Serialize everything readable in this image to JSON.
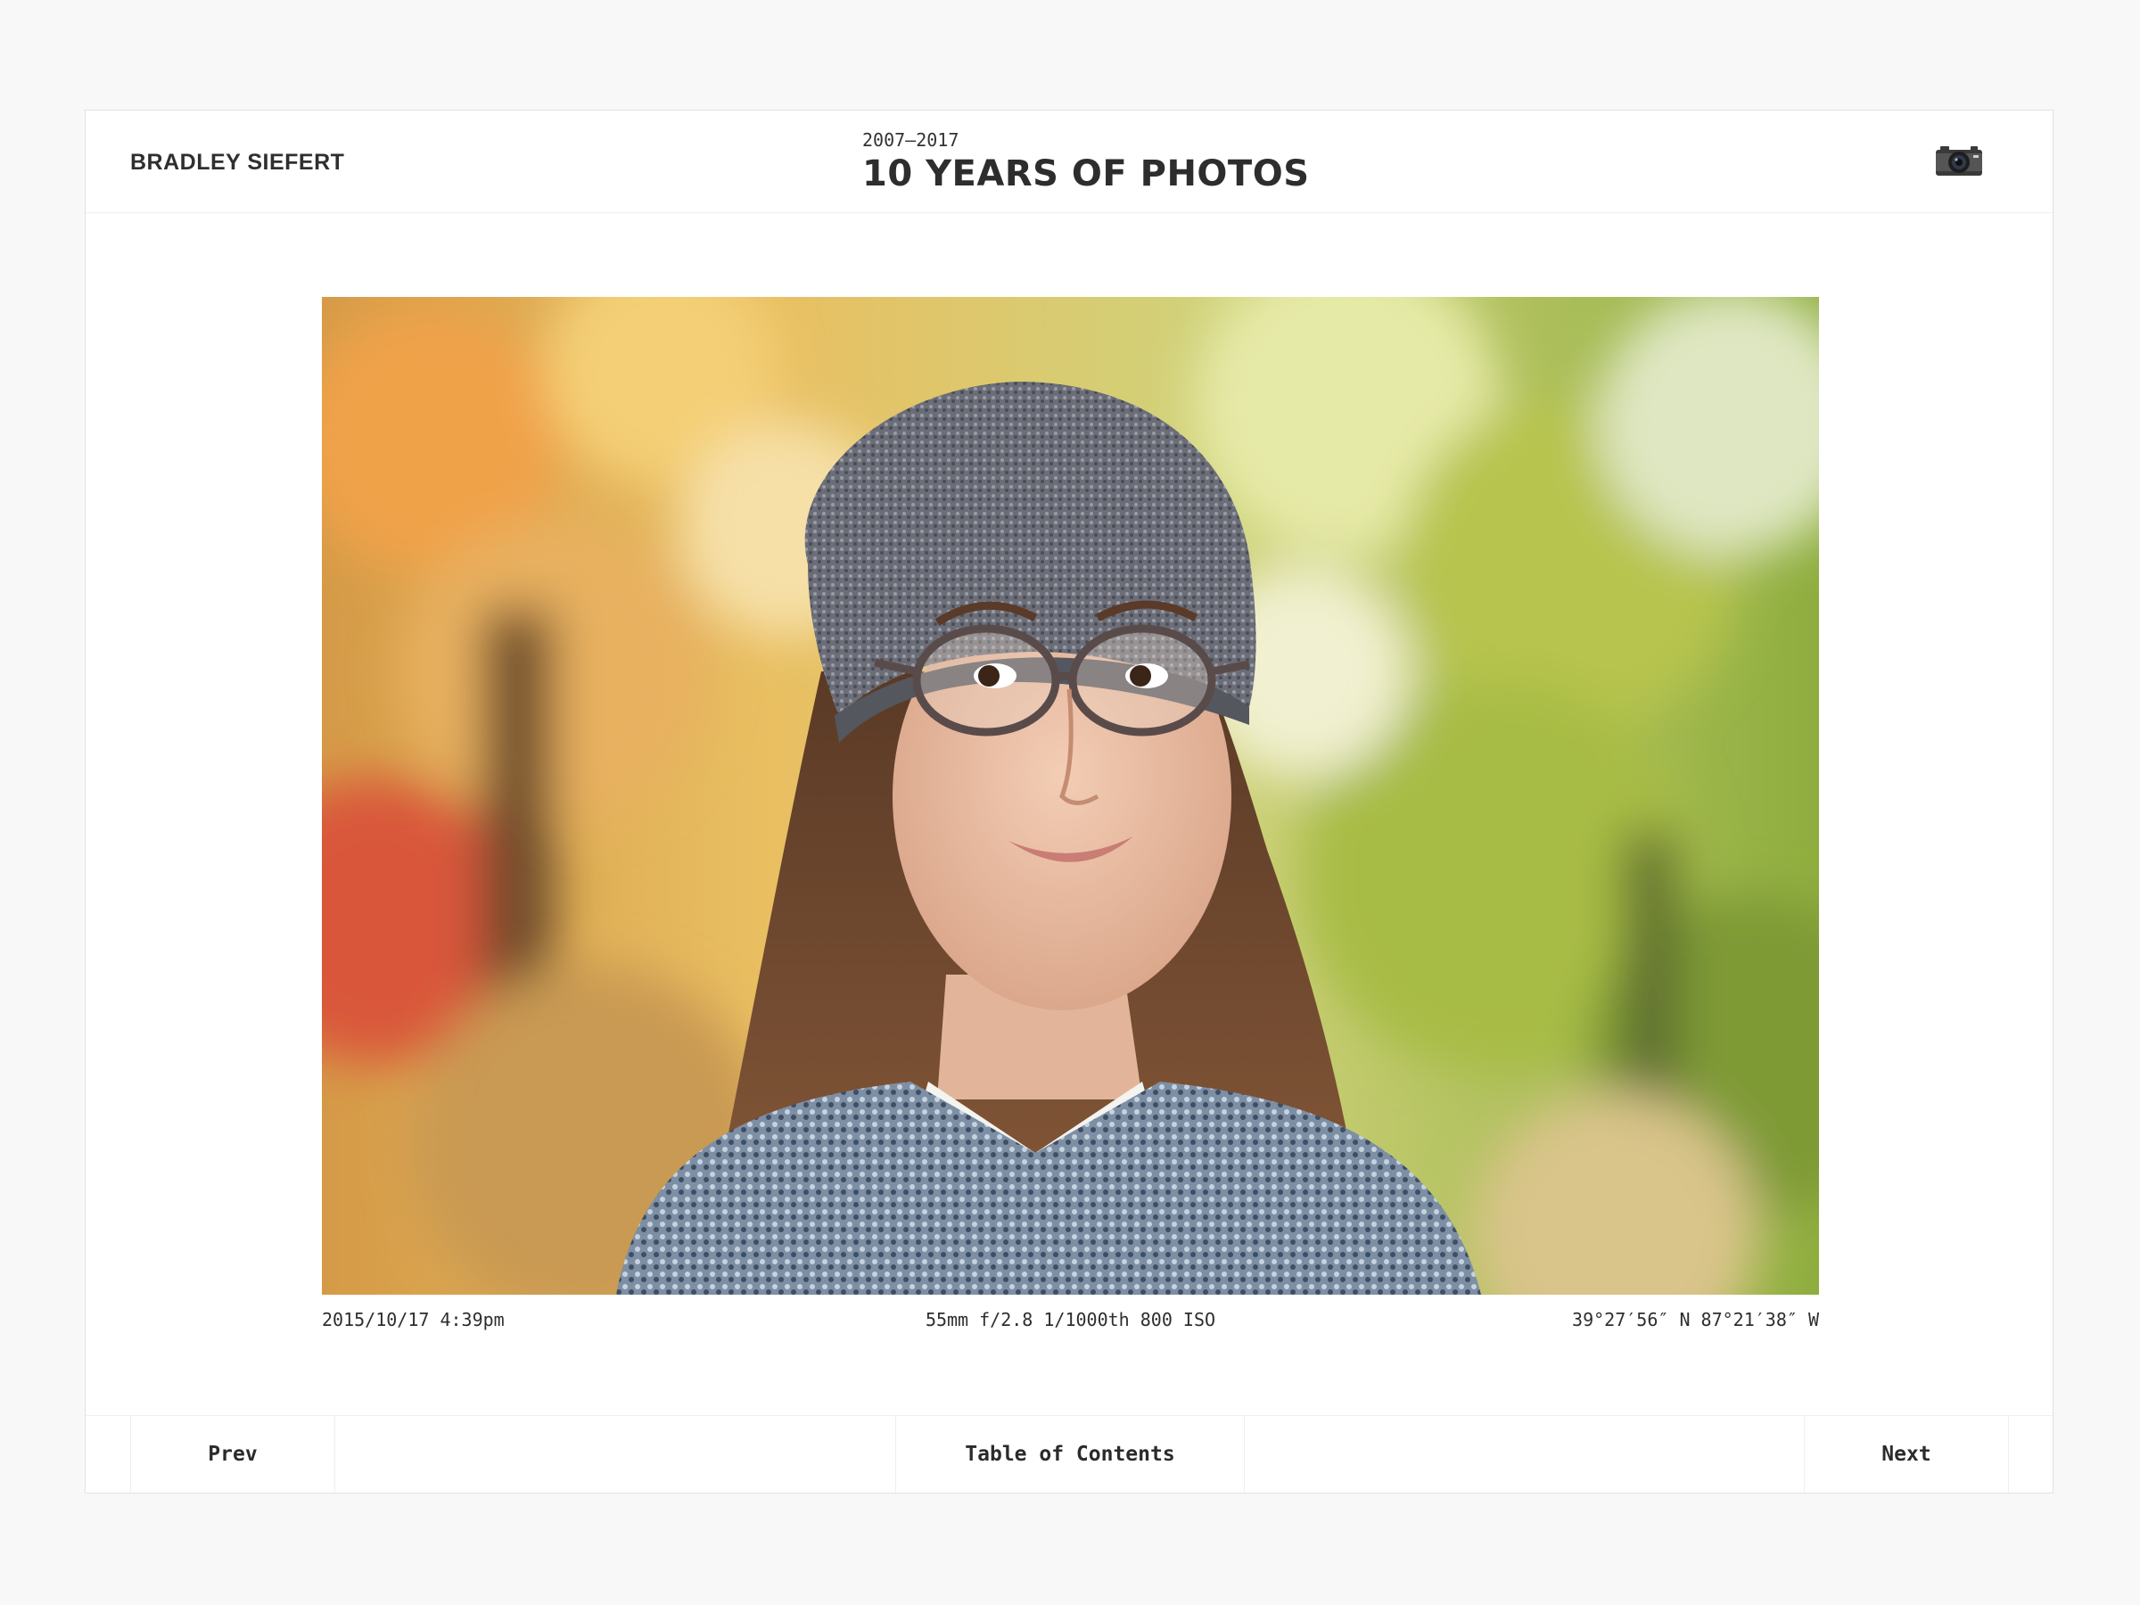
{
  "header": {
    "author": "BRADLEY SIEFERT",
    "years": "2007–2017",
    "title": "10 YEARS OF PHOTOS",
    "icon": "camera-icon"
  },
  "photo": {
    "description_icon": "photo-portrait",
    "date": "2015/10/17 4:39pm",
    "exposure": "55mm f/2.8 1/1000th 800 ISO",
    "coordinates": "39°27′56″ N 87°21′38″ W"
  },
  "footer": {
    "prev_label": "Prev",
    "toc_label": "Table of Contents",
    "next_label": "Next"
  },
  "colors": {
    "background": "#f8f8f8",
    "card": "#ffffff",
    "text": "#2b2b2b"
  }
}
